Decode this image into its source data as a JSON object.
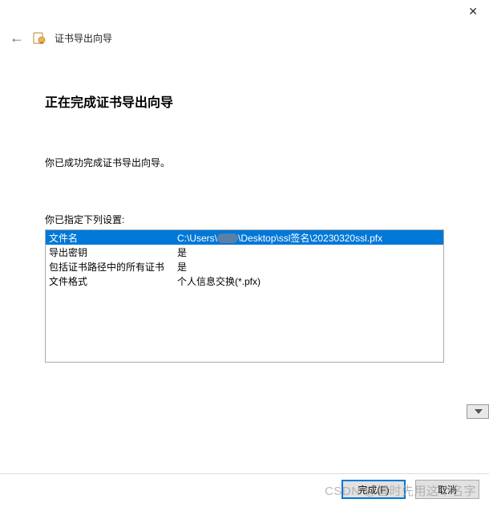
{
  "window": {
    "wizard_title": "证书导出向导",
    "close_tooltip": "Close"
  },
  "page": {
    "title": "正在完成证书导出向导",
    "instruction": "你已成功完成证书导出向导。",
    "settings_label": "你已指定下列设置:"
  },
  "settings": {
    "rows": [
      {
        "key": "文件名",
        "value_parts": [
          "C:\\Users\\",
          "\\Desktop\\ssl签名\\20230320ssl.pfx"
        ],
        "redacted": true
      },
      {
        "key": "导出密钥",
        "value": "是"
      },
      {
        "key": "包括证书路径中的所有证书",
        "value": "是"
      },
      {
        "key": "文件格式",
        "value": "个人信息交换(*.pfx)"
      }
    ]
  },
  "footer": {
    "finish_label": "完成(F)",
    "cancel_label": "取消"
  },
  "watermark": "CSDN @暂时先用这个名字"
}
